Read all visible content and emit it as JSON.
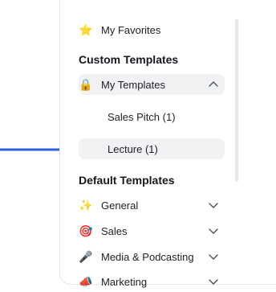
{
  "favorites": {
    "label": "My Favorites",
    "icon": "star-icon"
  },
  "custom_templates": {
    "heading": "Custom Templates",
    "my_templates": {
      "label": "My Templates",
      "icon": "lock-icon",
      "expanded": true
    },
    "items": [
      {
        "label": "Sales Pitch (1)"
      },
      {
        "label": "Lecture (1)"
      }
    ]
  },
  "default_templates": {
    "heading": "Default Templates",
    "items": [
      {
        "label": "General",
        "icon": "sparkles-icon"
      },
      {
        "label": "Sales",
        "icon": "target-icon"
      },
      {
        "label": "Media & Podcasting",
        "icon": "microphone-icon"
      },
      {
        "label": "Marketing",
        "icon": "megaphone-icon"
      }
    ]
  },
  "colors": {
    "accent": "#2f5fd6",
    "hover_bg": "#f1f2f4",
    "border": "#e4e6ea"
  }
}
